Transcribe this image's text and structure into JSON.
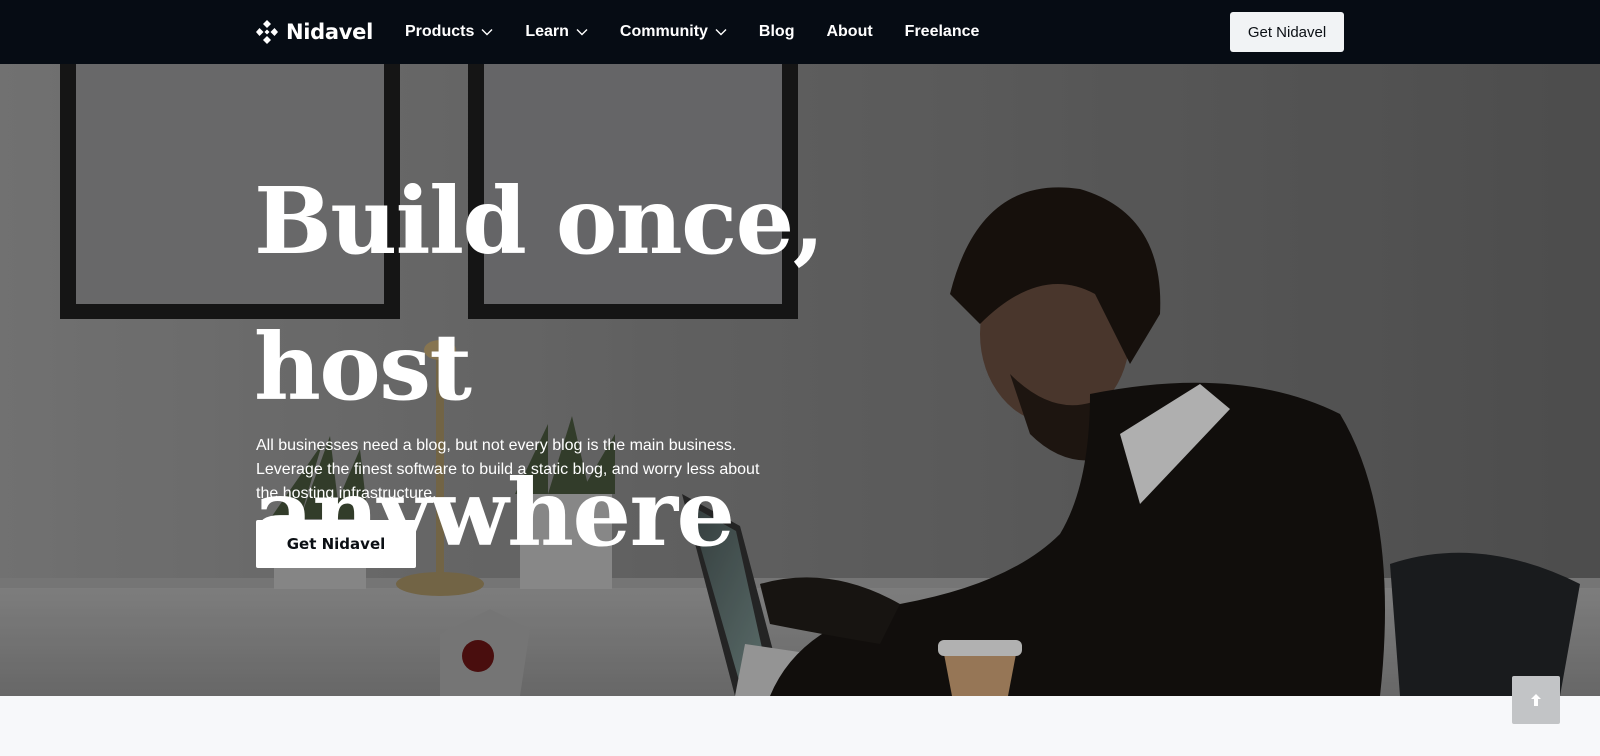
{
  "brand": {
    "name": "Nidavel",
    "logo_icon": "diamond-logo-icon"
  },
  "nav": {
    "items": [
      {
        "label": "Products",
        "has_dropdown": true
      },
      {
        "label": "Learn",
        "has_dropdown": true
      },
      {
        "label": "Community",
        "has_dropdown": true
      },
      {
        "label": "Blog",
        "has_dropdown": false
      },
      {
        "label": "About",
        "has_dropdown": false
      },
      {
        "label": "Freelance",
        "has_dropdown": false
      }
    ],
    "cta_label": "Get Nidavel"
  },
  "hero": {
    "title_line1": "Build once, host",
    "title_line2": "anywhere",
    "description": "All businesses need a blog, but not every blog is the main business. Leverage the finest software to build a static blog, and worry less about the hosting infrastructure.",
    "cta_label": "Get Nidavel",
    "background": "photo of a man using a laptop at a white desk with framed pictures and plants"
  },
  "scroll_top": {
    "icon": "arrow-up-icon"
  },
  "colors": {
    "nav_bg": "#060c14",
    "hero_text": "#ffffff",
    "button_bg": "#ffffff",
    "page_bg": "#f7f8fa"
  }
}
